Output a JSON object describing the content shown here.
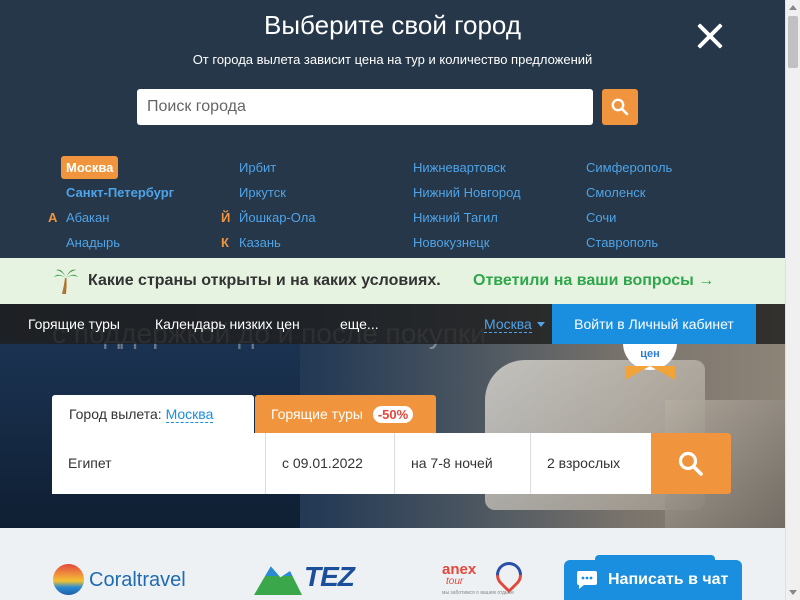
{
  "modal": {
    "title": "Выберите свой город",
    "subtitle": "От города вылета зависит цена на тур и количество предложений",
    "search_placeholder": "Поиск города",
    "icons": {
      "close": "close-icon",
      "search": "search-icon"
    },
    "columns": [
      {
        "items": [
          {
            "letter": "",
            "name": "Москва",
            "selected": true
          },
          {
            "letter": "",
            "name": "Санкт-Петербург",
            "bold": true
          },
          {
            "letter": "А",
            "name": "Абакан"
          },
          {
            "letter": "",
            "name": "Анадырь"
          }
        ]
      },
      {
        "items": [
          {
            "letter": "",
            "name": "Ирбит"
          },
          {
            "letter": "",
            "name": "Иркутск"
          },
          {
            "letter": "Й",
            "name": "Йошкар-Ола"
          },
          {
            "letter": "К",
            "name": "Казань"
          }
        ]
      },
      {
        "items": [
          {
            "letter": "",
            "name": "Нижневартовск"
          },
          {
            "letter": "",
            "name": "Нижний Новгород"
          },
          {
            "letter": "",
            "name": "Нижний Тагил"
          },
          {
            "letter": "",
            "name": "Новокузнецк"
          }
        ]
      },
      {
        "items": [
          {
            "letter": "",
            "name": "Симферополь"
          },
          {
            "letter": "",
            "name": "Смоленск"
          },
          {
            "letter": "",
            "name": "Сочи"
          },
          {
            "letter": "",
            "name": "Ставрополь"
          }
        ]
      }
    ]
  },
  "banner": {
    "text": "Какие страны открыты и на каких условиях.",
    "link": "Ответили на ваши вопросы →",
    "icon": "palm-tree-icon"
  },
  "hero": {
    "text": "с поддержкой до и после покупки",
    "badge": "цен"
  },
  "nav": {
    "items": [
      "Горящие туры",
      "Календарь низких цен",
      "еще..."
    ],
    "city": "Москва",
    "login": "Войти в Личный кабинет"
  },
  "search_form": {
    "city_label": "Город вылета:",
    "city_value": "Москва",
    "hot_tab": "Горящие туры",
    "hot_discount": "-50%",
    "destination": "Египет",
    "date": "с 09.01.2022",
    "nights": "на 7-8 ночей",
    "guests": "2 взрослых"
  },
  "partners": {
    "coral": "Coraltravel",
    "tez": "TEZ",
    "anex_top": "anex",
    "anex_bottom": "tour",
    "anex_tagline": "мы заботимся о вашем отдыхе"
  },
  "chat": {
    "label": "Написать в чат"
  },
  "colors": {
    "accent": "#f0953d",
    "link": "#4fa3e8",
    "primary": "#1a8fe0",
    "modal_bg": "#253748",
    "banner_bg": "#e7f3e1",
    "banner_link": "#2fa64b"
  }
}
